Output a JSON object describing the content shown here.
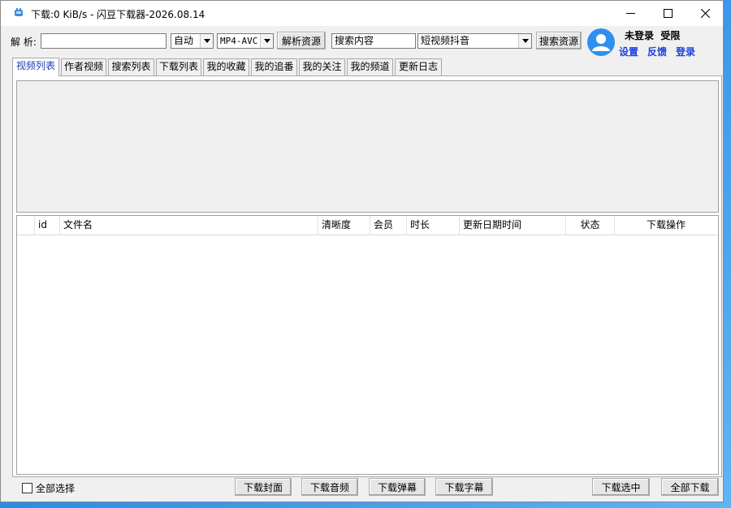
{
  "window": {
    "title": "下载:0 KiB/s - 闪豆下载器-2026.08.14"
  },
  "toolbar": {
    "parse_label": "解 析:",
    "url_value": "",
    "quality_select": "自动",
    "format_select": "MP4-AVC",
    "parse_button": "解析资源",
    "search_value": "搜索内容",
    "platform_select": "短视频抖音",
    "search_button": "搜索资源"
  },
  "user": {
    "status": "未登录",
    "limit": "受限",
    "settings": "设置",
    "feedback": "反馈",
    "login": "登录"
  },
  "tabs": [
    {
      "label": "视频列表",
      "active": true
    },
    {
      "label": "作者视频"
    },
    {
      "label": "搜索列表"
    },
    {
      "label": "下载列表"
    },
    {
      "label": "我的收藏"
    },
    {
      "label": "我的追番"
    },
    {
      "label": "我的关注"
    },
    {
      "label": "我的频道"
    },
    {
      "label": "更新日志"
    }
  ],
  "table": {
    "columns": [
      "",
      "id",
      "文件名",
      "清晰度",
      "会员",
      "时长",
      "更新日期时间",
      "状态",
      "下载操作"
    ],
    "rows": []
  },
  "bottom": {
    "select_all": "全部选择",
    "download_cover": "下载封面",
    "download_audio": "下载音频",
    "download_danmaku": "下载弹幕",
    "download_subtitle": "下载字幕",
    "download_selected": "下载选中",
    "download_all": "全部下载"
  },
  "colors": {
    "link": "#1a3fe0",
    "avatar": "#2f8ff0",
    "active_tab_text": "#1a3fb0"
  }
}
